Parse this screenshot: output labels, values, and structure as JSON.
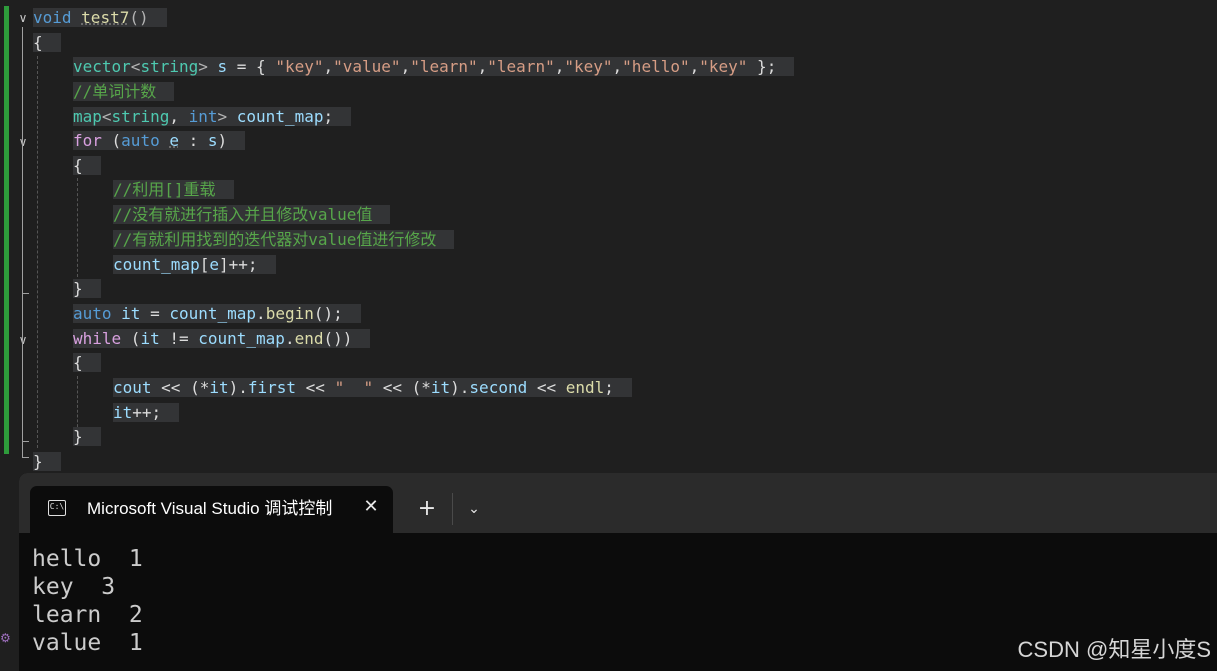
{
  "editor": {
    "lines": [
      {
        "tokens": [
          {
            "t": "void",
            "c": "kw"
          },
          {
            "t": " ",
            "c": ""
          },
          {
            "t": "test7",
            "c": "fn sq"
          },
          {
            "t": "()",
            "c": "op"
          }
        ]
      },
      {
        "tokens": [
          {
            "t": "{",
            "c": ""
          }
        ]
      },
      {
        "tokens": [
          {
            "t": "vector",
            "c": "ty"
          },
          {
            "t": "<",
            "c": "op"
          },
          {
            "t": "string",
            "c": "ty"
          },
          {
            "t": "> ",
            "c": "op"
          },
          {
            "t": "s",
            "c": "var"
          },
          {
            "t": " = { ",
            "c": ""
          },
          {
            "t": "\"key\"",
            "c": "str"
          },
          {
            "t": ",",
            "c": ""
          },
          {
            "t": "\"value\"",
            "c": "str"
          },
          {
            "t": ",",
            "c": ""
          },
          {
            "t": "\"learn\"",
            "c": "str"
          },
          {
            "t": ",",
            "c": ""
          },
          {
            "t": "\"learn\"",
            "c": "str"
          },
          {
            "t": ",",
            "c": ""
          },
          {
            "t": "\"key\"",
            "c": "str"
          },
          {
            "t": ",",
            "c": ""
          },
          {
            "t": "\"hello\"",
            "c": "str"
          },
          {
            "t": ",",
            "c": ""
          },
          {
            "t": "\"key\"",
            "c": "str"
          },
          {
            "t": " };",
            "c": ""
          }
        ]
      },
      {
        "tokens": [
          {
            "t": "//单词计数",
            "c": "cm"
          }
        ]
      },
      {
        "tokens": [
          {
            "t": "map",
            "c": "ty"
          },
          {
            "t": "<",
            "c": "op"
          },
          {
            "t": "string",
            "c": "ty"
          },
          {
            "t": ", ",
            "c": ""
          },
          {
            "t": "int",
            "c": "kw"
          },
          {
            "t": "> ",
            "c": "op"
          },
          {
            "t": "count_map",
            "c": "var"
          },
          {
            "t": ";",
            "c": ""
          }
        ]
      },
      {
        "tokens": [
          {
            "t": "for",
            "c": "kw2"
          },
          {
            "t": " (",
            "c": ""
          },
          {
            "t": "auto",
            "c": "kw"
          },
          {
            "t": " ",
            "c": ""
          },
          {
            "t": "e",
            "c": "var sq"
          },
          {
            "t": " : ",
            "c": ""
          },
          {
            "t": "s",
            "c": "var"
          },
          {
            "t": ")",
            "c": ""
          }
        ]
      },
      {
        "tokens": [
          {
            "t": "{",
            "c": ""
          }
        ]
      },
      {
        "tokens": [
          {
            "t": "//利用[]重载",
            "c": "cm"
          }
        ]
      },
      {
        "tokens": [
          {
            "t": "//没有就进行插入并且修改value值",
            "c": "cm"
          }
        ]
      },
      {
        "tokens": [
          {
            "t": "//有就利用找到的迭代器对value值进行修改",
            "c": "cm"
          }
        ]
      },
      {
        "tokens": [
          {
            "t": "count_map",
            "c": "var"
          },
          {
            "t": "[",
            "c": ""
          },
          {
            "t": "e",
            "c": "var"
          },
          {
            "t": "]++;",
            "c": ""
          }
        ]
      },
      {
        "tokens": [
          {
            "t": "}",
            "c": ""
          }
        ]
      },
      {
        "tokens": [
          {
            "t": "auto",
            "c": "kw"
          },
          {
            "t": " ",
            "c": ""
          },
          {
            "t": "it",
            "c": "var"
          },
          {
            "t": " = ",
            "c": ""
          },
          {
            "t": "count_map",
            "c": "var"
          },
          {
            "t": ".",
            "c": ""
          },
          {
            "t": "begin",
            "c": "fn"
          },
          {
            "t": "();",
            "c": ""
          }
        ]
      },
      {
        "tokens": [
          {
            "t": "while",
            "c": "kw2"
          },
          {
            "t": " (",
            "c": ""
          },
          {
            "t": "it",
            "c": "var"
          },
          {
            "t": " != ",
            "c": ""
          },
          {
            "t": "count_map",
            "c": "var"
          },
          {
            "t": ".",
            "c": ""
          },
          {
            "t": "end",
            "c": "fn"
          },
          {
            "t": "())",
            "c": ""
          }
        ]
      },
      {
        "tokens": [
          {
            "t": "{",
            "c": ""
          }
        ]
      },
      {
        "tokens": [
          {
            "t": "cout",
            "c": "var"
          },
          {
            "t": " << (*",
            "c": ""
          },
          {
            "t": "it",
            "c": "var"
          },
          {
            "t": ").",
            "c": ""
          },
          {
            "t": "first",
            "c": "var"
          },
          {
            "t": " << ",
            "c": ""
          },
          {
            "t": "\"  \"",
            "c": "str"
          },
          {
            "t": " << (*",
            "c": ""
          },
          {
            "t": "it",
            "c": "var"
          },
          {
            "t": ").",
            "c": ""
          },
          {
            "t": "second",
            "c": "var"
          },
          {
            "t": " << ",
            "c": ""
          },
          {
            "t": "endl",
            "c": "fn"
          },
          {
            "t": ";",
            "c": ""
          }
        ]
      },
      {
        "tokens": [
          {
            "t": "it",
            "c": "var"
          },
          {
            "t": "++;",
            "c": ""
          }
        ]
      },
      {
        "tokens": [
          {
            "t": "}",
            "c": ""
          }
        ]
      },
      {
        "tokens": [
          {
            "t": "}",
            "c": ""
          }
        ]
      }
    ]
  },
  "terminal": {
    "tab_icon": "C:\\",
    "tab_icon_name": "console-window-icon",
    "tab_title": "Microsoft Visual Studio 调试控制台",
    "close_glyph": "✕",
    "new_tab_glyph": "+",
    "dropdown_glyph": "⌄",
    "output": [
      "hello  1",
      "key  3",
      "learn  2",
      "value  1"
    ]
  },
  "watermark": "CSDN @知星小度S",
  "colors": {
    "editor_bg": "#1f1f1f",
    "change_bar": "#2e9b3b",
    "terminal_bg": "#0c0c0c",
    "tabstrip_bg": "#2b2b2b"
  }
}
